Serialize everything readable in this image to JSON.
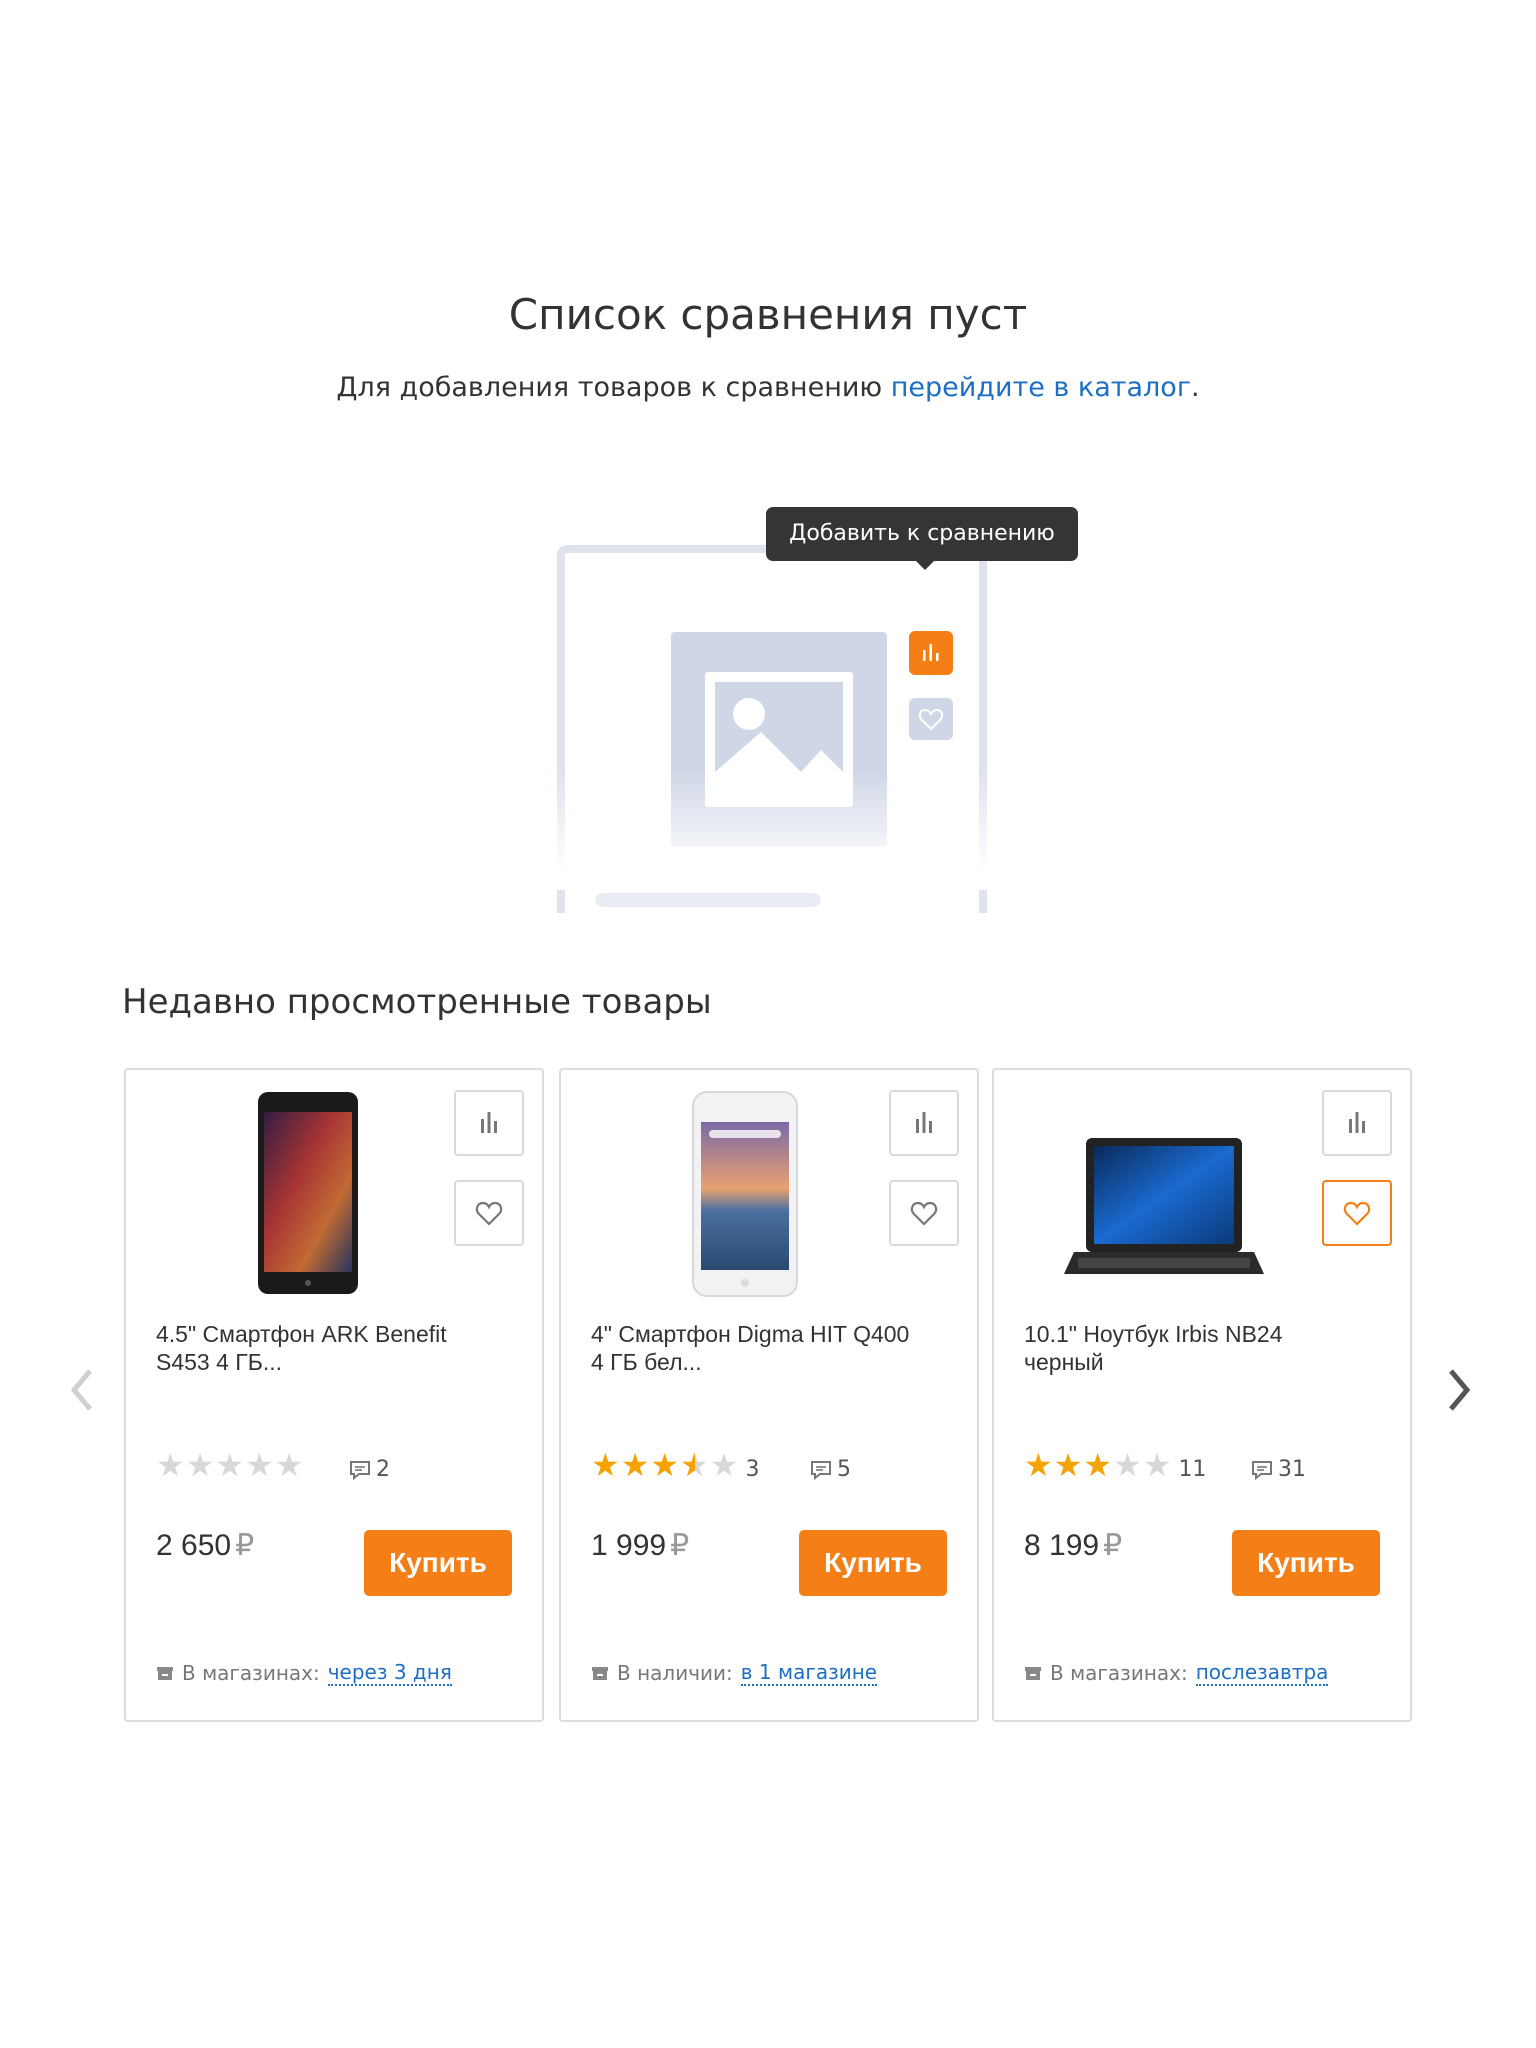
{
  "empty": {
    "title": "Список сравнения пуст",
    "subtitle_prefix": "Для добавления товаров к сравнению ",
    "subtitle_link": "перейдите в каталог",
    "subtitle_suffix": ".",
    "tooltip": "Добавить к сравнению"
  },
  "recent": {
    "title": "Недавно просмотренные товары",
    "products": [
      {
        "name": "4.5\" Смартфон ARK Benefit S453 4 ГБ...",
        "rating": 0,
        "rating_count": "",
        "reviews": "2",
        "price": "2 650",
        "currency": "₽",
        "buy_label": "Купить",
        "avail_label": "В магазинах:",
        "avail_link": "через 3 дня",
        "favorite_active": false
      },
      {
        "name": "4\" Смартфон Digma HIT Q400 4 ГБ бел...",
        "rating": 3.5,
        "rating_count": "3",
        "reviews": "5",
        "price": "1 999",
        "currency": "₽",
        "buy_label": "Купить",
        "avail_label": "В наличии:",
        "avail_link": "в 1 магазине",
        "favorite_active": false
      },
      {
        "name": "10.1\" Ноутбук Irbis NB24 черный",
        "rating": 3,
        "rating_count": "11",
        "reviews": "31",
        "price": "8 199",
        "currency": "₽",
        "buy_label": "Купить",
        "avail_label": "В магазинах:",
        "avail_link": "послезавтра",
        "favorite_active": true
      }
    ]
  },
  "colors": {
    "accent": "#f57f17",
    "link": "#1e6fc4",
    "star": "#f5a300"
  }
}
